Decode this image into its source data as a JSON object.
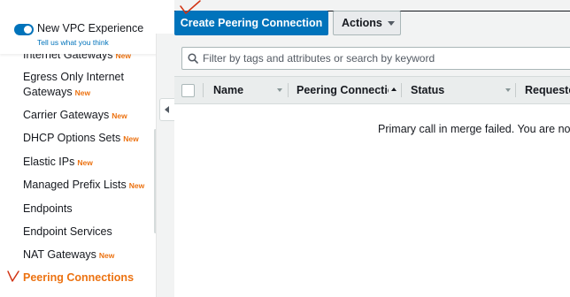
{
  "vpc_panel": {
    "title": "New VPC Experience",
    "link": "Tell us what you think",
    "toggle_on": true
  },
  "sidebar": {
    "items": [
      {
        "label": "Internet Gateways",
        "badge": "New"
      },
      {
        "label": "Egress Only Internet",
        "label_line2": "Gateways",
        "badge": "New"
      },
      {
        "label": "Carrier Gateways",
        "badge": "New"
      },
      {
        "label": "DHCP Options Sets",
        "badge": "New"
      },
      {
        "label": "Elastic IPs",
        "badge": "New"
      },
      {
        "label": "Managed Prefix Lists",
        "badge": "New"
      },
      {
        "label": "Endpoints"
      },
      {
        "label": "Endpoint Services"
      },
      {
        "label": "NAT Gateways",
        "badge": "New"
      },
      {
        "label": "Peering Connections",
        "active": true
      }
    ]
  },
  "toolbar": {
    "create_label": "Create Peering Connection",
    "actions_label": "Actions"
  },
  "filter": {
    "placeholder": "Filter by tags and attributes or search by keyword"
  },
  "table": {
    "columns": [
      "Name",
      "Peering Connectio",
      "Status",
      "Requeste"
    ]
  },
  "message": "Primary call in merge failed. You are not a",
  "colors": {
    "primary": "#0073bb",
    "accent": "#ec7211",
    "annotation": "#d13212"
  }
}
